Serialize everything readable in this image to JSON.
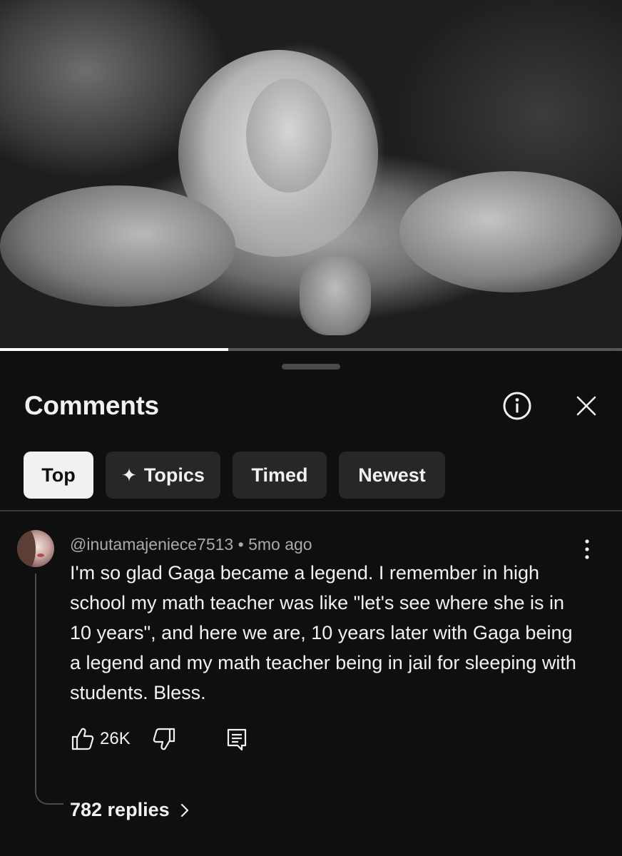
{
  "video": {
    "progress_fraction": 0.367
  },
  "comments_panel": {
    "title": "Comments",
    "info_icon": "info-icon",
    "close_icon": "close-icon",
    "filters": [
      {
        "label": "Top",
        "active": true
      },
      {
        "label": "Topics",
        "icon": "sparkle-icon",
        "icon_glyph": "✦",
        "active": false
      },
      {
        "label": "Timed",
        "active": false
      },
      {
        "label": "Newest",
        "active": false
      }
    ]
  },
  "comment": {
    "author": "@inutamajeniece7513",
    "separator": " • ",
    "time": "5mo ago",
    "text": "I'm so glad Gaga became a legend. I remember in high school my math teacher was like \"let's see where she is in 10 years\", and here we are, 10 years later with Gaga being a legend and my math teacher being in jail for sleeping with students. Bless.",
    "likes": "26K",
    "replies_label": "782 replies"
  },
  "colors": {
    "background": "#0f0f0f",
    "chip_bg": "#272727",
    "chip_active_bg": "#f1f1f1",
    "text_primary": "#f1f1f1",
    "text_secondary": "#aaaaaa"
  }
}
